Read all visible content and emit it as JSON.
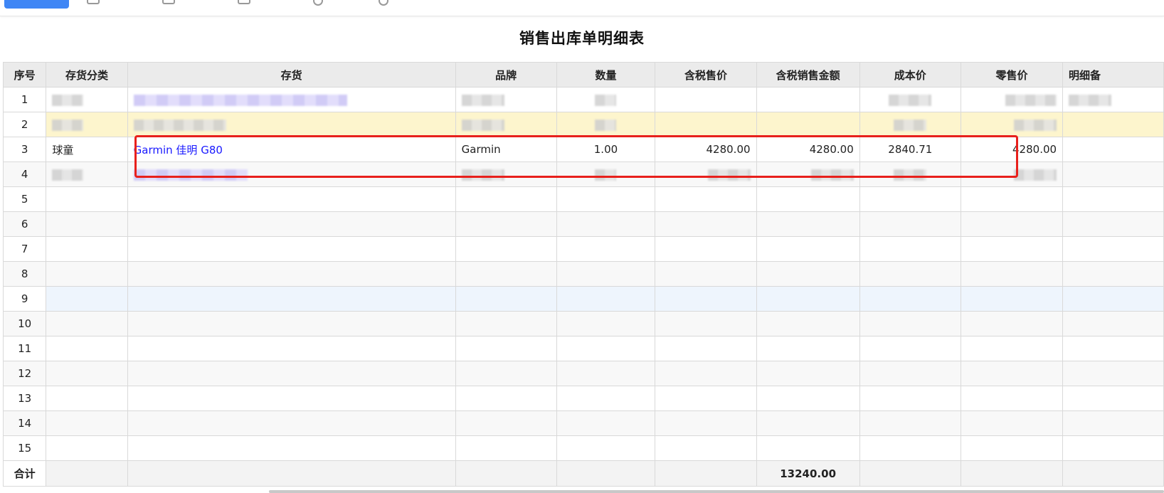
{
  "report": {
    "title": "销售出库单明细表"
  },
  "table": {
    "headers": [
      "序号",
      "存货分类",
      "存货",
      "品牌",
      "数量",
      "含税售价",
      "含税销售金额",
      "成本价",
      "零售价",
      "明细备"
    ],
    "visible_row": {
      "seq": "3",
      "category": "球童",
      "item": "Garmin 佳明 G80",
      "brand": "Garmin",
      "quantity": "1.00",
      "tax_price": "4280.00",
      "tax_amount": "4280.00",
      "cost_price": "2840.71",
      "retail_price": "4280.00"
    },
    "row_numbers": [
      "1",
      "2",
      "3",
      "4",
      "5",
      "6",
      "7",
      "8",
      "9",
      "10",
      "11",
      "12",
      "13",
      "14",
      "15"
    ],
    "footer": {
      "label": "合计",
      "tax_amount_total": "13240.00"
    }
  },
  "colors": {
    "primary_button": "#3f86f5",
    "highlight_box": "#e8201c",
    "row_yellow": "#fdf5cd",
    "row_blue": "#eef5fd",
    "link_text": "#1a1aff"
  }
}
